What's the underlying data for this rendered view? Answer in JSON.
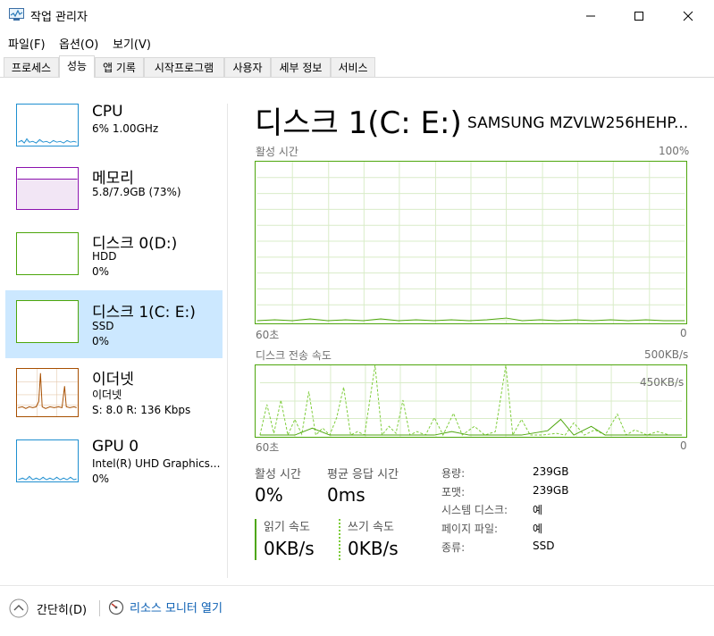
{
  "window": {
    "title": "작업 관리자"
  },
  "menu": [
    "파일(F)",
    "옵션(O)",
    "보기(V)"
  ],
  "tabs": [
    "프로세스",
    "성능",
    "앱 기록",
    "시작프로그램",
    "사용자",
    "세부 정보",
    "서비스"
  ],
  "active_tab": "성능",
  "colors": {
    "accent": "#4da60c",
    "selected": "#cce8ff",
    "cpu": "#1f8fd0",
    "memory": "#8b12ae",
    "ethernet": "#a74f01"
  },
  "sidebar": [
    {
      "title": "CPU",
      "sub1": "6%  1.00GHz",
      "sub2": ""
    },
    {
      "title": "메모리",
      "sub1": "5.8/7.9GB (73%)",
      "sub2": ""
    },
    {
      "title": "디스크 0(D:)",
      "sub1": "HDD",
      "sub2": "0%"
    },
    {
      "title": "디스크 1(C: E:)",
      "sub1": "SSD",
      "sub2": "0%"
    },
    {
      "title": "이더넷",
      "sub1": "이더넷",
      "sub2": "S:  8.0  R:  136 Kbps"
    },
    {
      "title": "GPU 0",
      "sub1": "Intel(R) UHD Graphics...",
      "sub2": "0%"
    }
  ],
  "main": {
    "title": "디스크 1(C: E:)",
    "model": "SAMSUNG MZVLW256HEHP...",
    "graph1": {
      "label": "활성 시간",
      "max": "100%",
      "left": "60초",
      "right": "0"
    },
    "graph2": {
      "label": "디스크 전송 속도",
      "max": "500KB/s",
      "inner": "450KB/s",
      "left": "60초",
      "right": "0"
    },
    "stats": {
      "active_label": "활성 시간",
      "active_value": "0%",
      "resp_label": "평균 응답 시간",
      "resp_value": "0ms",
      "read_label": "읽기 속도",
      "read_value": "0KB/s",
      "write_label": "쓰기 속도",
      "write_value": "0KB/s"
    },
    "props": [
      {
        "k": "용량:",
        "v": "239GB"
      },
      {
        "k": "포맷:",
        "v": "239GB"
      },
      {
        "k": "시스템 디스크:",
        "v": "예"
      },
      {
        "k": "페이지 파일:",
        "v": "예"
      },
      {
        "k": "종류:",
        "v": "SSD"
      }
    ]
  },
  "footer": {
    "brief": "간단히(D)",
    "monitor": "리소스 모니터 열기"
  }
}
